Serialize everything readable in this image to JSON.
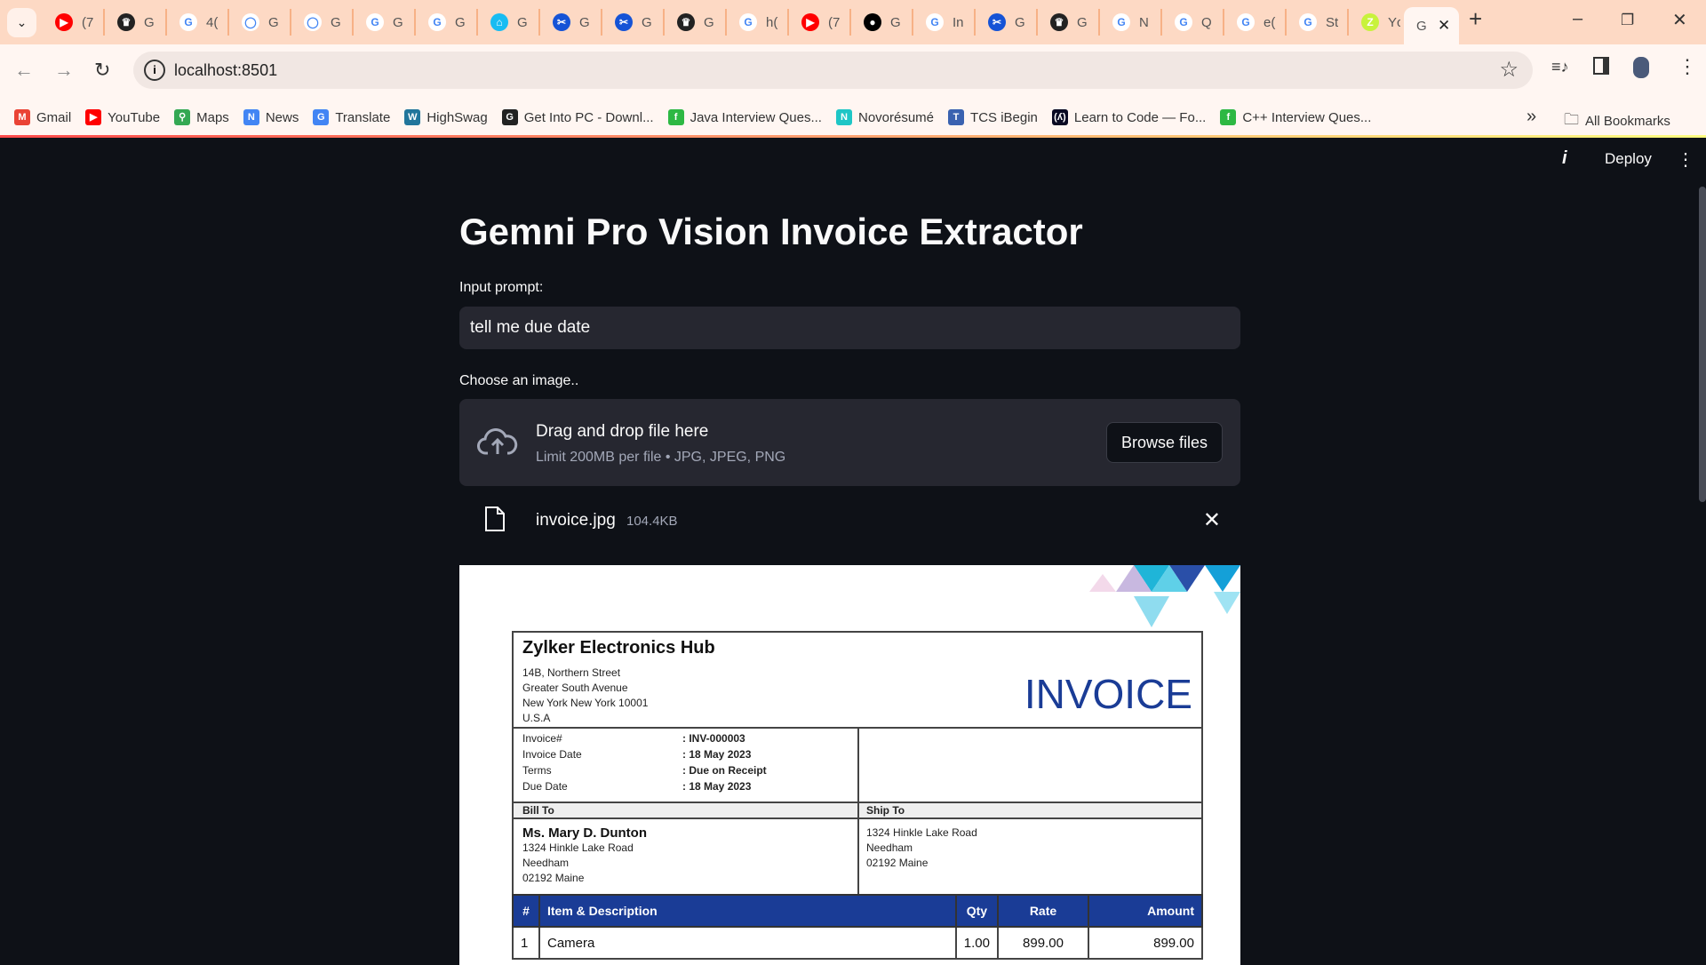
{
  "browser": {
    "tabs": [
      {
        "icon": "youtube",
        "c": "#f00",
        "g": "▶",
        "t": "(7"
      },
      {
        "icon": "crown",
        "c": "#222",
        "g": "♛",
        "t": "G"
      },
      {
        "icon": "google",
        "c": "#fff",
        "g": "G",
        "t": "4("
      },
      {
        "icon": "github",
        "c": "#fff",
        "g": "◯",
        "t": "G"
      },
      {
        "icon": "github",
        "c": "#fff",
        "g": "◯",
        "t": "G"
      },
      {
        "icon": "google",
        "c": "#fff",
        "g": "G",
        "t": "G"
      },
      {
        "icon": "google",
        "c": "#fff",
        "g": "G",
        "t": "G"
      },
      {
        "icon": "home-assistant",
        "c": "#18bcf2",
        "g": "⌂",
        "t": "G"
      },
      {
        "icon": "scissors",
        "c": "#1553d6",
        "g": "✂",
        "t": "G"
      },
      {
        "icon": "scissors",
        "c": "#1553d6",
        "g": "✂",
        "t": "G"
      },
      {
        "icon": "crown",
        "c": "#222",
        "g": "♛",
        "t": "G"
      },
      {
        "icon": "google",
        "c": "#fff",
        "g": "G",
        "t": "h("
      },
      {
        "icon": "youtube",
        "c": "#f00",
        "g": "▶",
        "t": "(7"
      },
      {
        "icon": "medium",
        "c": "#000",
        "g": "●",
        "t": "G"
      },
      {
        "icon": "google",
        "c": "#fff",
        "g": "G",
        "t": "In"
      },
      {
        "icon": "scissors",
        "c": "#1553d6",
        "g": "✂",
        "t": "G"
      },
      {
        "icon": "crown",
        "c": "#222",
        "g": "♛",
        "t": "G"
      },
      {
        "icon": "google",
        "c": "#fff",
        "g": "G",
        "t": "N"
      },
      {
        "icon": "google",
        "c": "#fff",
        "g": "G",
        "t": "Q"
      },
      {
        "icon": "google",
        "c": "#fff",
        "g": "G",
        "t": "e("
      },
      {
        "icon": "google",
        "c": "#fff",
        "g": "G",
        "t": "St"
      },
      {
        "icon": "zdnet",
        "c": "#c8f23c",
        "g": "Z",
        "t": "Yc"
      }
    ],
    "active_tab": "G",
    "url": "localhost:8501",
    "bookmarks": [
      {
        "label": "Gmail",
        "c": "#ea4335",
        "g": "M"
      },
      {
        "label": "YouTube",
        "c": "#f00",
        "g": "▶"
      },
      {
        "label": "Maps",
        "c": "#34a853",
        "g": "⚲"
      },
      {
        "label": "News",
        "c": "#4285f4",
        "g": "N"
      },
      {
        "label": "Translate",
        "c": "#4285f4",
        "g": "G"
      },
      {
        "label": "HighSwag",
        "c": "#21759b",
        "g": "W"
      },
      {
        "label": "Get Into PC - Downl...",
        "c": "#222",
        "g": "G"
      },
      {
        "label": "Java Interview Ques...",
        "c": "#2db843",
        "g": "f"
      },
      {
        "label": "Novorésumé",
        "c": "#1ec6c6",
        "g": "N"
      },
      {
        "label": "TCS iBegin",
        "c": "#3a62b0",
        "g": "T"
      },
      {
        "label": "Learn to Code — Fo...",
        "c": "#0a0a23",
        "g": "(ʎ)"
      },
      {
        "label": "C++ Interview Ques...",
        "c": "#2db843",
        "g": "f"
      }
    ],
    "all_bookmarks": "All Bookmarks"
  },
  "header": {
    "deploy": "Deploy"
  },
  "app": {
    "title": "Gemni Pro Vision Invoice Extractor",
    "prompt_label": "Input prompt:",
    "prompt_value": "tell me due date",
    "upload_label": "Choose an image..",
    "drop_text": "Drag and drop file here",
    "limit_text": "Limit 200MB per file • JPG, JPEG, PNG",
    "browse": "Browse files",
    "file_name": "invoice.jpg",
    "file_size": "104.4KB"
  },
  "invoice": {
    "company": "Zylker Electronics Hub",
    "address": [
      "14B, Northern Street",
      "Greater South Avenue",
      "New York New York 10001",
      "U.S.A"
    ],
    "heading": "INVOICE",
    "meta": [
      [
        "Invoice#",
        ": INV-000003"
      ],
      [
        "Invoice Date",
        ": 18 May 2023"
      ],
      [
        "Terms",
        ": Due on Receipt"
      ],
      [
        "Due Date",
        ": 18 May 2023"
      ]
    ],
    "bill_to": "Bill To",
    "ship_to": "Ship To",
    "bill_name": "Ms. Mary D. Dunton",
    "bill_addr": [
      "1324 Hinkle Lake Road",
      "Needham",
      "02192 Maine"
    ],
    "ship_addr": [
      "1324 Hinkle Lake Road",
      "Needham",
      "02192 Maine"
    ],
    "columns": [
      "#",
      "Item & Description",
      "Qty",
      "Rate",
      "Amount"
    ],
    "rows": [
      [
        "1",
        "Camera",
        "1.00",
        "899.00",
        "899.00"
      ]
    ],
    "accent": "#1a3c96"
  }
}
